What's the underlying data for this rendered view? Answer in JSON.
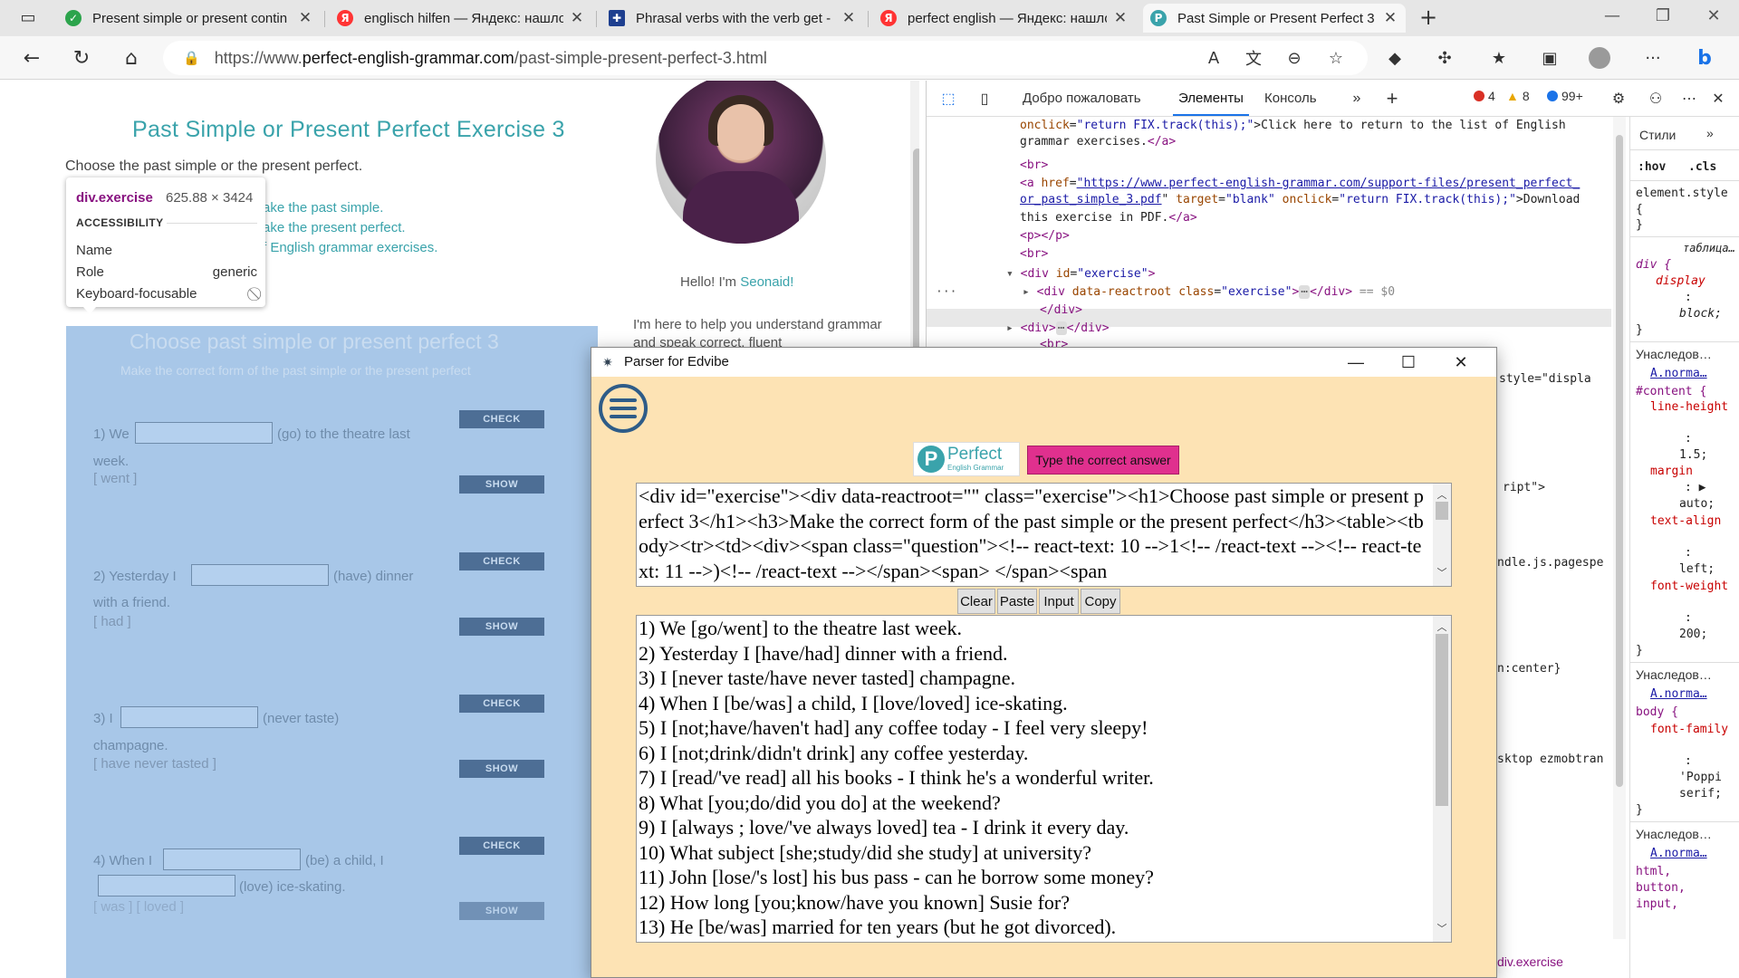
{
  "browser": {
    "tabs": [
      {
        "title": "Present simple or present contin",
        "favicon": "check-icon",
        "color": "#2ca44c"
      },
      {
        "title": "englisch hilfen — Яндекс: нашло",
        "favicon": "yandex-icon",
        "color": "#f33"
      },
      {
        "title": "Phrasal verbs with the verb get -",
        "favicon": "uk-flag-icon",
        "color": "#1e3f8f"
      },
      {
        "title": "perfect english — Яндекс: нашло",
        "favicon": "yandex-icon",
        "color": "#f33"
      },
      {
        "title": "Past Simple or Present Perfect 3",
        "favicon": "p-icon",
        "color": "#3aa3ab"
      }
    ],
    "url_prefix": "https://www.",
    "url_domain": "perfect-english-grammar.com",
    "url_path": "/past-simple-present-perfect-3.html"
  },
  "page": {
    "title": "Past Simple or Present Perfect Exercise 3",
    "subtitle": "Choose the past simple or the present perfect.",
    "links": [
      "ake the past simple.",
      "ake the present perfect.",
      "f English grammar exercises."
    ],
    "hello_prefix": "Hello! I'm ",
    "hello_name": "Seonaid!",
    "intro": "I'm here to help you understand grammar and speak correct, fluent",
    "exercise": {
      "h1": "Choose past simple or present perfect 3",
      "h3": "Make the correct form of the past simple or the present perfect",
      "check_label": "CHECK",
      "show_label": "SHOW",
      "items": [
        {
          "before": "1) We",
          "after": "(go) to the theatre last",
          "line2": "week.",
          "answer": "[ went ]"
        },
        {
          "before": "2) Yesterday I",
          "after": "(have) dinner",
          "line2": "with a friend.",
          "answer": "[ had ]"
        },
        {
          "before": "3) I",
          "after": "(never taste)",
          "line2": "champagne.",
          "answer": "[ have never tasted ]"
        },
        {
          "before": "4) When I",
          "after": "(be) a child, I",
          "line2": "(love) ice-skating.",
          "answer": "[ was ] [ loved ]"
        }
      ]
    },
    "tooltip": {
      "tag": "div.exercise",
      "size": "625.88 × 3424",
      "section": "ACCESSIBILITY",
      "rows": [
        {
          "label": "Name",
          "value": ""
        },
        {
          "label": "Role",
          "value": "generic"
        },
        {
          "label": "Keyboard-focusable",
          "value": ""
        }
      ]
    }
  },
  "devtools": {
    "tabs": [
      "Добро пожаловать",
      "Элементы",
      "Консоль"
    ],
    "errors": "4",
    "warnings": "8",
    "messages": "99+",
    "code": [
      "onclick=\"return FIX.track(this);\">Click here to return to the list of English",
      "grammar exercises.</a>",
      "<br>",
      "<a href=\"https://www.perfect-english-grammar.com/support-files/present_perfect_",
      "or_past_simple_3.pdf\" target=\"blank\" onclick=\"return FIX.track(this);\">Download",
      "this exercise in PDF.</a>",
      "<p></p>",
      "<br>",
      "<div id=\"exercise\">",
      "<div data-reactroot class=\"exercise\">",
      "</div>",
      "<div>",
      "<br>"
    ],
    "partial_lines": [
      "style=\"displa",
      "ript\">",
      "ndle.js.pagespe",
      "n:center}",
      "sktop ezmobtran"
    ],
    "selected_suffix": "== $0",
    "styles_tabs": [
      "Стили",
      ":hov",
      ".cls"
    ],
    "styles": {
      "element_style": "element.style {",
      "table_rule_label": "таблица…",
      "div_rule": "div {",
      "display": "display",
      "block": "block;",
      "inherited": "Унаследов…",
      "link_a": "A.norma…",
      "content_rule": "#content {",
      "line_height": "line-height",
      "v15": "1.5;",
      "margin": "margin",
      "auto": "auto;",
      "text_align": "text-align",
      "left": "left;",
      "font_weight": "font-weight",
      "v200": "200;",
      "body_rule": "body {",
      "font_family": "font-family",
      "poppins": "'Poppi",
      "serif": "serif;",
      "html_rule": "html,",
      "button": "button,",
      "input": "input,"
    },
    "breadcrumb": "div.exercise"
  },
  "app": {
    "title": "Parser for Edvibe",
    "logo_main": "Perfect",
    "logo_sub": "English Grammar",
    "mode_button": "Type the correct answer",
    "source_html": "<div id=\"exercise\"><div data-reactroot=\"\" class=\"exercise\"><h1>Choose past simple or present perfect 3</h1><h3>Make the correct form of the past simple or the present perfect</h3><table><tbody><tr><td><div><span class=\"question\"><!-- react-text: 10 -->1<!-- /react-text --><!-- react-text: 11 -->)<!-- /react-text --></span><span> </span><span",
    "buttons": [
      "Clear",
      "Paste",
      "Input",
      "Copy"
    ],
    "output_lines": [
      "1) We [go/went] to the theatre last week.",
      "2) Yesterday I [have/had] dinner with a friend.",
      "3) I [never taste/have never tasted] champagne.",
      "4) When I [be/was] a child, I [love/loved] ice-skating.",
      "5) I [not;have/haven't had] any coffee today - I feel very sleepy!",
      "6) I [not;drink/didn't drink] any coffee yesterday.",
      "7) I [read/'ve read] all his books - I think he's a wonderful writer.",
      "8) What [you;do/did you do] at the weekend?",
      "9) I [always ; love/'ve always loved] tea - I drink it every day.",
      "10) What subject [she;study/did she study] at university?",
      "11) John [lose/'s lost] his bus pass - can he borrow some money?",
      "12) How long [you;know/have you known] Susie for?",
      "13) He [be/was] married for ten years (but he got divorced)."
    ]
  }
}
